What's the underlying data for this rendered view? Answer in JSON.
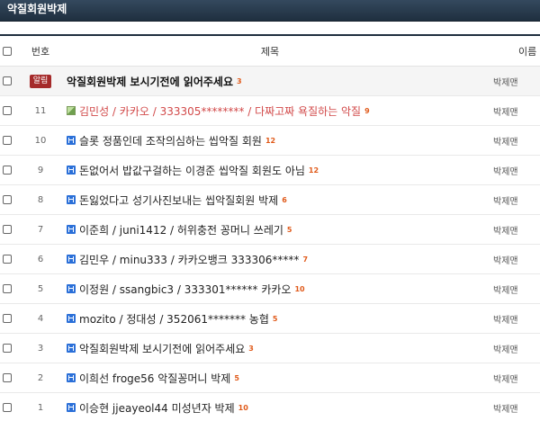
{
  "board": {
    "title": "악질회원박제"
  },
  "header": {
    "number": "번호",
    "title": "제목",
    "author": "이름"
  },
  "rows": [
    {
      "number": "알림",
      "title": "악질회원박제 보시기전에 읽어주세요",
      "comments": "3",
      "author": "박제맨",
      "type": "notice"
    },
    {
      "number": "11",
      "title": "김민성 / 카카오 / 333305******** / 다짜고짜 욕질하는 악질",
      "comments": "9",
      "author": "박제맨",
      "type": "image"
    },
    {
      "number": "10",
      "title": "슬롯 정품인데 조작의심하는 씹악질 회원",
      "comments": "12",
      "author": "박제맨",
      "type": "doc"
    },
    {
      "number": "9",
      "title": "돈없어서 밥값구걸하는 이경준 씹악질 회원도 아님",
      "comments": "12",
      "author": "박제맨",
      "type": "doc"
    },
    {
      "number": "8",
      "title": "돈잃었다고 성기사진보내는 씹악질회원 박제",
      "comments": "6",
      "author": "박제맨",
      "type": "doc"
    },
    {
      "number": "7",
      "title": "이준희 / juni1412 / 허위충전 꽁머니 쓰레기",
      "comments": "5",
      "author": "박제맨",
      "type": "doc"
    },
    {
      "number": "6",
      "title": "김민우 / minu333 / 카카오뱅크 333306*****",
      "comments": "7",
      "author": "박제맨",
      "type": "doc"
    },
    {
      "number": "5",
      "title": "이정원 / ssangbic3 / 333301****** 카카오",
      "comments": "10",
      "author": "박제맨",
      "type": "doc"
    },
    {
      "number": "4",
      "title": "mozito / 정대성 / 352061******* 농협",
      "comments": "5",
      "author": "박제맨",
      "type": "doc"
    },
    {
      "number": "3",
      "title": "악질회원박제 보시기전에 읽어주세요",
      "comments": "3",
      "author": "박제맨",
      "type": "doc"
    },
    {
      "number": "2",
      "title": "이희선 froge56 악질꽁머니 박제",
      "comments": "5",
      "author": "박제맨",
      "type": "doc"
    },
    {
      "number": "1",
      "title": "이승현 jjeayeol44 미성년자 박제",
      "comments": "10",
      "author": "박제맨",
      "type": "doc"
    }
  ]
}
